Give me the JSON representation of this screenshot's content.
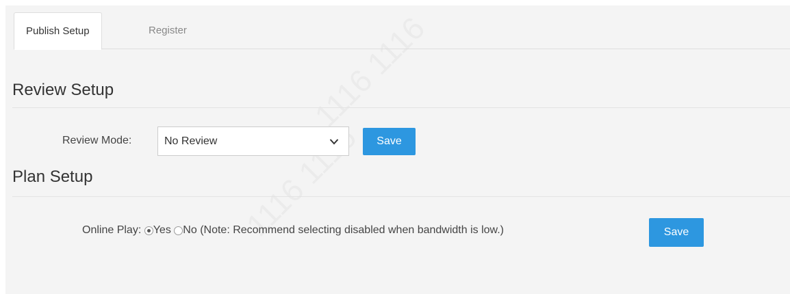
{
  "tabs": [
    {
      "label": "Publish Setup",
      "active": true
    },
    {
      "label": "Register",
      "active": false
    }
  ],
  "review_section": {
    "title": "Review Setup",
    "mode_label": "Review Mode:",
    "mode_value": "No Review",
    "save_label": "Save"
  },
  "plan_section": {
    "title": "Plan Setup",
    "online_play_label": "Online Play:",
    "options": [
      {
        "label": "Yes",
        "checked": true
      },
      {
        "label": "No",
        "checked": false
      }
    ],
    "note": "(Note: Recommend selecting disabled when bandwidth is low.)",
    "save_label": "Save"
  },
  "colors": {
    "accent": "#2d97e0",
    "background": "#f4f4f4"
  }
}
